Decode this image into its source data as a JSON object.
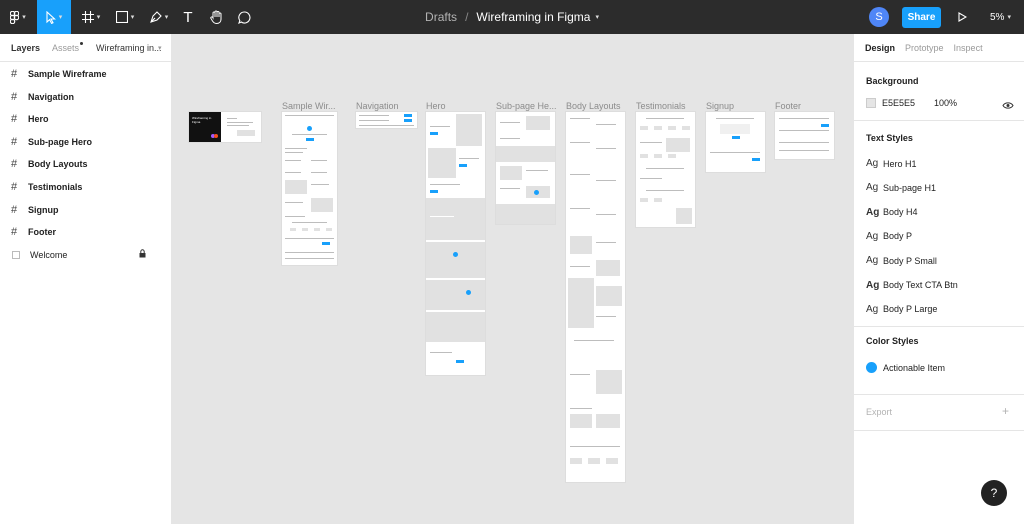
{
  "toolbar": {
    "tools": [
      {
        "name": "figma-menu",
        "icon": "figma-logo-icon"
      },
      {
        "name": "move-tool",
        "icon": "cursor-icon"
      },
      {
        "name": "frame-tool",
        "icon": "frame-hash-icon"
      },
      {
        "name": "shape-tool",
        "icon": "rectangle-icon"
      },
      {
        "name": "pen-tool",
        "icon": "pen-icon"
      },
      {
        "name": "text-tool",
        "icon": "text-icon"
      },
      {
        "name": "hand-tool",
        "icon": "hand-icon"
      },
      {
        "name": "comment-tool",
        "icon": "comment-icon"
      }
    ],
    "text_tool_label": "T",
    "avatar_initial": "S",
    "share_label": "Share",
    "zoom_label": "5%",
    "accent_color": "#18a0fb"
  },
  "breadcrumb": {
    "folder": "Drafts",
    "separator": "/",
    "file": "Wireframing in Figma"
  },
  "left_panel": {
    "tab_layers": "Layers",
    "tab_assets": "Assets",
    "page_name": "Wireframing in...",
    "layers": [
      {
        "label": "Sample Wireframe"
      },
      {
        "label": "Navigation"
      },
      {
        "label": "Hero"
      },
      {
        "label": "Sub-page Hero"
      },
      {
        "label": "Body Layouts"
      },
      {
        "label": "Testimonials"
      },
      {
        "label": "Signup"
      },
      {
        "label": "Footer"
      },
      {
        "label": "Welcome"
      }
    ]
  },
  "canvas": {
    "background": "#E5E5E5",
    "frame_labels": [
      "Sample Wir...",
      "Navigation",
      "Hero",
      "Sub-page He...",
      "Body Layouts",
      "Testimonials",
      "Signup",
      "Footer"
    ],
    "welcome_text": "Wireframing in Figma"
  },
  "right_panel": {
    "tabs": [
      "Design",
      "Prototype",
      "Inspect"
    ],
    "background_title": "Background",
    "background_hex": "E5E5E5",
    "background_opacity": "100%",
    "text_styles_title": "Text Styles",
    "text_style_glyph": "Ag",
    "text_styles": [
      "Hero H1",
      "Sub-page H1",
      "Body H4",
      "Body P",
      "Body P Small",
      "Body Text CTA Btn",
      "Body P Large"
    ],
    "color_styles_title": "Color Styles",
    "color_styles": [
      {
        "label": "Actionable Item",
        "color": "#18A0FB"
      }
    ],
    "export_title": "Export",
    "export_plus": "+",
    "help_label": "?"
  }
}
